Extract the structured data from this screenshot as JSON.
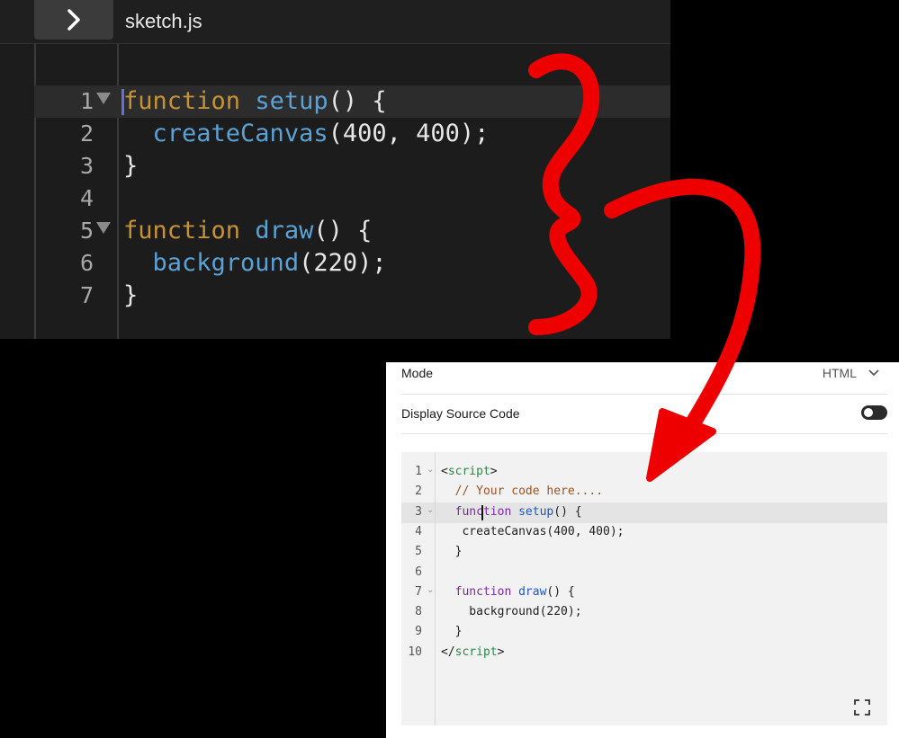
{
  "editor": {
    "file_name": "sketch.js",
    "lines": [
      {
        "num": "1",
        "parts": [
          {
            "t": "function",
            "c": "kw"
          },
          {
            "t": " "
          },
          {
            "t": "setup",
            "c": "fn"
          },
          {
            "t": "() {"
          }
        ]
      },
      {
        "num": "2",
        "parts": [
          {
            "t": "  "
          },
          {
            "t": "createCanvas",
            "c": "fn"
          },
          {
            "t": "(400, 400);"
          }
        ]
      },
      {
        "num": "3",
        "parts": [
          {
            "t": "}"
          }
        ]
      },
      {
        "num": "4",
        "parts": []
      },
      {
        "num": "5",
        "parts": [
          {
            "t": "function",
            "c": "kw"
          },
          {
            "t": " "
          },
          {
            "t": "draw",
            "c": "fn"
          },
          {
            "t": "() {"
          }
        ]
      },
      {
        "num": "6",
        "parts": [
          {
            "t": "  "
          },
          {
            "t": "background",
            "c": "fn"
          },
          {
            "t": "(220);"
          }
        ]
      },
      {
        "num": "7",
        "parts": [
          {
            "t": "}"
          }
        ]
      }
    ]
  },
  "panel": {
    "mode_label": "Mode",
    "mode_value": "HTML",
    "display_source_label": "Display Source Code",
    "display_source_on": false,
    "code_lines": [
      {
        "num": "1",
        "parts": [
          {
            "t": "<"
          },
          {
            "t": "script",
            "c": "tag"
          },
          {
            "t": ">"
          }
        ]
      },
      {
        "num": "2",
        "parts": [
          {
            "t": "  "
          },
          {
            "t": "// Your code here....",
            "c": "cm"
          }
        ]
      },
      {
        "num": "3",
        "parts": [
          {
            "t": "  "
          },
          {
            "t": "function",
            "c": "kw"
          },
          {
            "t": " "
          },
          {
            "t": "setup",
            "c": "fn"
          },
          {
            "t": "() {"
          }
        ]
      },
      {
        "num": "4",
        "parts": [
          {
            "t": "   createCanvas(400, 400);"
          }
        ]
      },
      {
        "num": "5",
        "parts": [
          {
            "t": "  }"
          }
        ]
      },
      {
        "num": "6",
        "parts": []
      },
      {
        "num": "7",
        "parts": [
          {
            "t": "  "
          },
          {
            "t": "function",
            "c": "kw"
          },
          {
            "t": " "
          },
          {
            "t": "draw",
            "c": "fn"
          },
          {
            "t": "() {"
          }
        ]
      },
      {
        "num": "8",
        "parts": [
          {
            "t": "    background(220);"
          }
        ]
      },
      {
        "num": "9",
        "parts": [
          {
            "t": "  }"
          }
        ]
      },
      {
        "num": "10",
        "parts": [
          {
            "t": "</"
          },
          {
            "t": "script",
            "c": "tag"
          },
          {
            "t": ">"
          }
        ]
      }
    ]
  },
  "colors": {
    "annotation_red": "#ee0000",
    "keyword_dark": "#c69236",
    "function_dark": "#5aa2d6"
  }
}
